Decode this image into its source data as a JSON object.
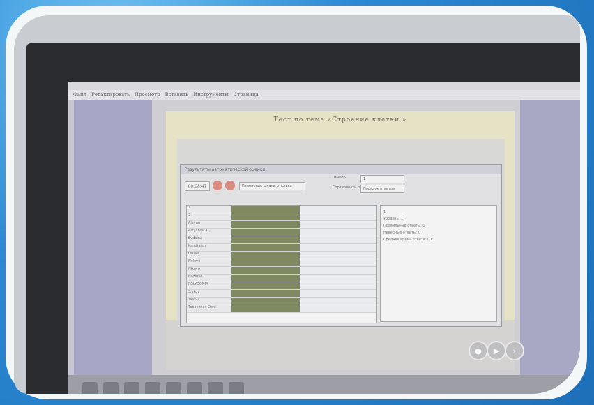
{
  "slide": {
    "title": "Тест  по  теме  «Строение     клетки  »"
  },
  "menu": [
    "Файл",
    "Редактировать",
    "Просмотр",
    "Вставить",
    "Инструменты",
    "Страница"
  ],
  "dialog": {
    "title": "Результаты автоматической оценки",
    "time": "00:08:47",
    "view_combo": "Изменение шкалы отклика",
    "filter_label": "Выбор",
    "sort_label": "Сортировать по",
    "sort_combo": "Порядок ответов",
    "filter_combo": "1"
  },
  "students": [
    {
      "name": "1"
    },
    {
      "name": "2"
    },
    {
      "name": "Alayan"
    },
    {
      "name": "Alsyanov A."
    },
    {
      "name": "Evdoina"
    },
    {
      "name": "Kandrakov"
    },
    {
      "name": "Liuska"
    },
    {
      "name": "Nelovo"
    },
    {
      "name": "Nikovo"
    },
    {
      "name": "Nazarilo"
    },
    {
      "name": "POLYGONIA"
    },
    {
      "name": "Sivkov"
    },
    {
      "name": "Tarova"
    },
    {
      "name": "Tabouzhov Deni"
    }
  ],
  "stats": [
    "1",
    "Уровень: 1",
    "Правильные ответы: 0",
    "Неверные ответы: 0",
    "Среднее время ответа: 0 с"
  ]
}
